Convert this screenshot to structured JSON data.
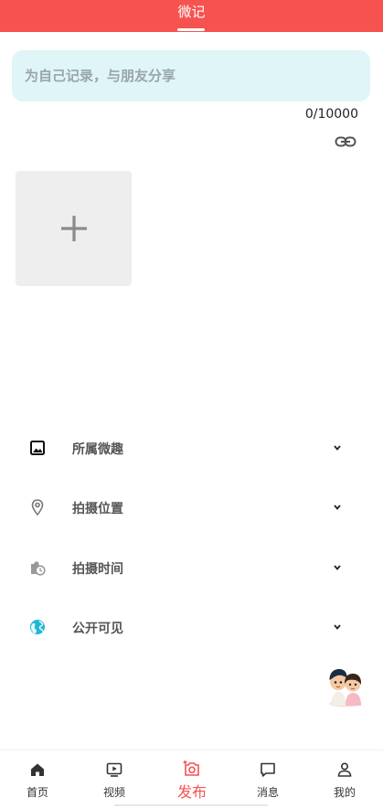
{
  "header": {
    "title": "微记"
  },
  "composer": {
    "placeholder": "为自己记录，与朋友分享",
    "value": "",
    "char_count": "0/10000"
  },
  "options": [
    {
      "label": "所属微趣",
      "icon": "image-icon"
    },
    {
      "label": "拍摄位置",
      "icon": "location-pin-icon"
    },
    {
      "label": "拍摄时间",
      "icon": "camera-clock-icon"
    },
    {
      "label": "公开可见",
      "icon": "globe-icon"
    }
  ],
  "nav": [
    {
      "label": "首页",
      "icon": "home-icon"
    },
    {
      "label": "视频",
      "icon": "video-icon"
    },
    {
      "label": "发布",
      "icon": "camera-plus-icon"
    },
    {
      "label": "消息",
      "icon": "message-icon"
    },
    {
      "label": "我的",
      "icon": "user-icon"
    }
  ],
  "colors": {
    "accent": "#f6524f",
    "input_bg": "#dff5f7",
    "globe": "#1fb7d3"
  }
}
